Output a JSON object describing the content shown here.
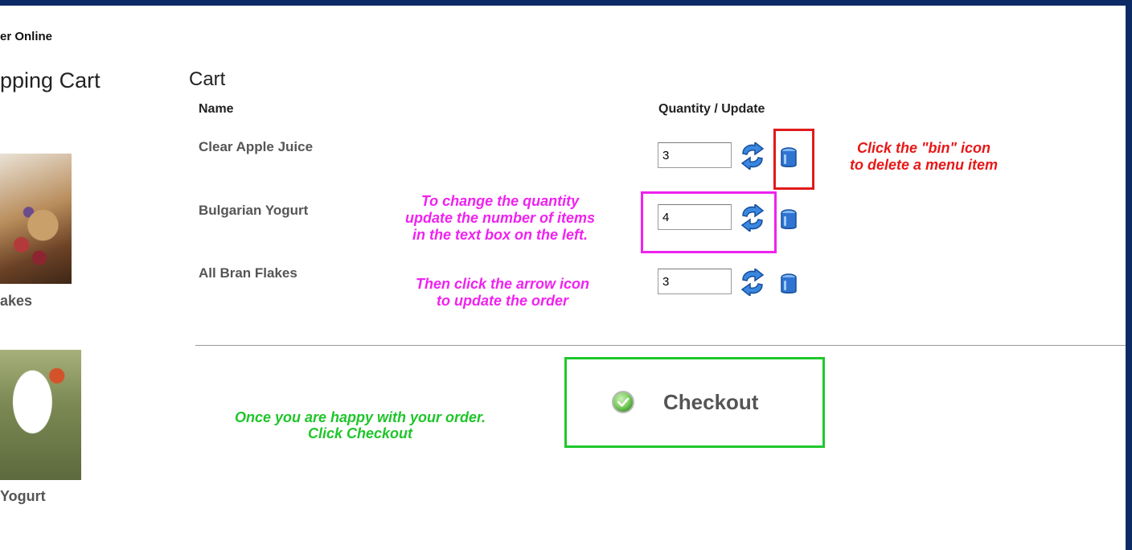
{
  "sidebar": {
    "brand": "er Online",
    "title": "pping Cart",
    "products": [
      {
        "label": "akes"
      },
      {
        "label": "Yogurt"
      }
    ]
  },
  "cart": {
    "title": "Cart",
    "columns": {
      "name": "Name",
      "quantity": "Quantity / Update"
    },
    "items": [
      {
        "name": "Clear Apple Juice",
        "quantity": "3"
      },
      {
        "name": "Bulgarian Yogurt",
        "quantity": "4"
      },
      {
        "name": "All Bran Flakes",
        "quantity": "3"
      }
    ],
    "update_icon": "refresh-arrows-icon",
    "delete_icon": "bin-icon"
  },
  "annotations": {
    "delete_line1": "Click the \"bin\" icon",
    "delete_line2": "to delete a menu item",
    "quantity_line1": "To change the quantity",
    "quantity_line2": "update the number of items",
    "quantity_line3": "in the text box on the left.",
    "update_line1": "Then click the arrow icon",
    "update_line2": "to update the order",
    "checkout_line1": "Once you are happy with your order.",
    "checkout_line2": "Click Checkout"
  },
  "checkout": {
    "label": "Checkout",
    "icon": "green-check-icon"
  },
  "colors": {
    "frame": "#0d2a66",
    "annotation_red": "#e81818",
    "annotation_magenta": "#f022f0",
    "annotation_green": "#1fc52a",
    "icon_blue": "#1f6fd6"
  }
}
